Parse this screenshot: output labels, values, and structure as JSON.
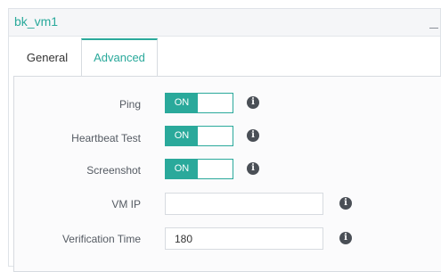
{
  "panel": {
    "title": "bk_vm1"
  },
  "tabs": [
    {
      "label": "General",
      "active": false
    },
    {
      "label": "Advanced",
      "active": true
    }
  ],
  "form": {
    "ping": {
      "label": "Ping",
      "toggle": "ON"
    },
    "heartbeat": {
      "label": "Heartbeat Test",
      "toggle": "ON"
    },
    "screenshot": {
      "label": "Screenshot",
      "toggle": "ON"
    },
    "vm_ip": {
      "label": "VM IP",
      "value": ""
    },
    "verification_time": {
      "label": "Verification Time",
      "value": "180"
    }
  },
  "colors": {
    "accent": "#2aa99b",
    "info_icon": "#4a4f56"
  },
  "icons": {
    "info": "i",
    "collapse": "minus-icon"
  }
}
